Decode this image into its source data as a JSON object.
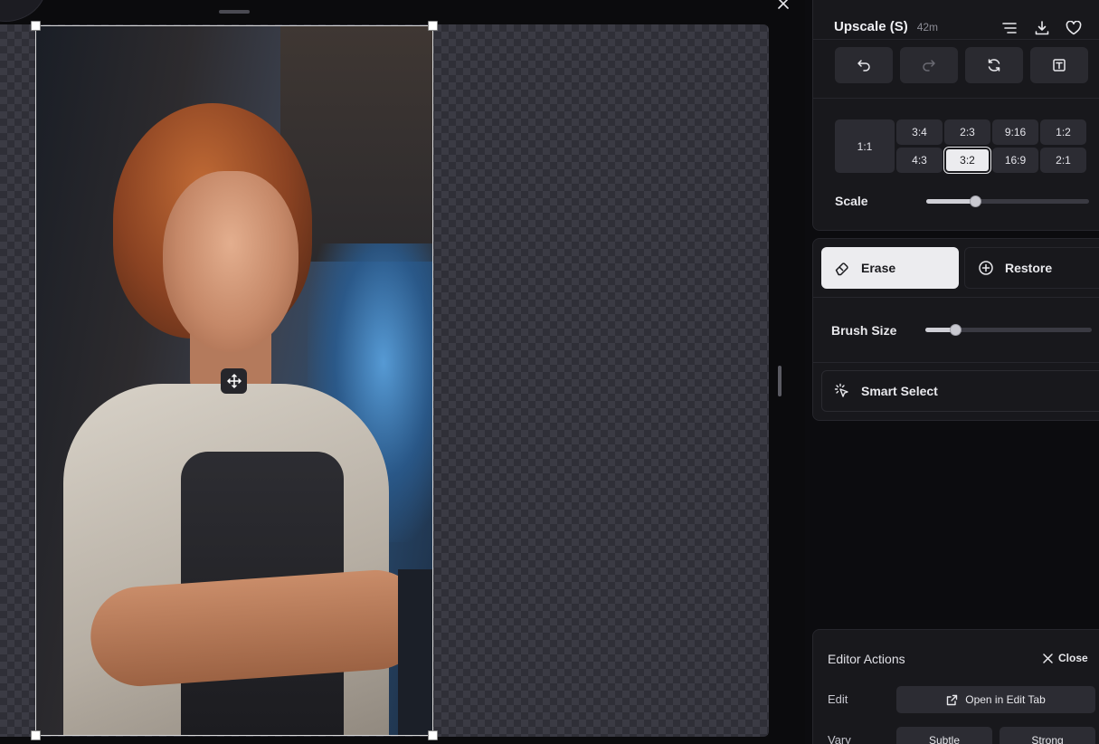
{
  "header": {
    "title": "Upscale (S)",
    "duration": "42m"
  },
  "icons": {
    "menu": "lines-icon",
    "download": "download-icon",
    "favorite": "heart-icon",
    "close": "close-icon"
  },
  "toolbar": {
    "undo": "undo-icon",
    "redo": "redo-icon",
    "refresh": "refresh-icon",
    "text": "text-box-icon"
  },
  "aspect_ratios": {
    "square": "1:1",
    "top": [
      "3:4",
      "2:3",
      "9:16",
      "1:2"
    ],
    "bottom": [
      "4:3",
      "3:2",
      "16:9",
      "2:1"
    ],
    "selected": "3:2"
  },
  "scale": {
    "label": "Scale",
    "value": 0.3
  },
  "brush": {
    "erase_label": "Erase",
    "restore_label": "Restore",
    "active": "Erase",
    "size_label": "Brush Size",
    "size_value": 0.18,
    "smart_select_label": "Smart Select"
  },
  "editor_actions": {
    "title": "Editor Actions",
    "close_label": "Close",
    "edit_label": "Edit",
    "open_edit_label": "Open in Edit Tab",
    "vary_label": "Vary",
    "subtle_label": "Subtle",
    "strong_label": "Strong"
  },
  "colors": {
    "panel_bg": "#18181c",
    "selected_bg": "#ececef",
    "button_bg": "#2c2c33"
  }
}
